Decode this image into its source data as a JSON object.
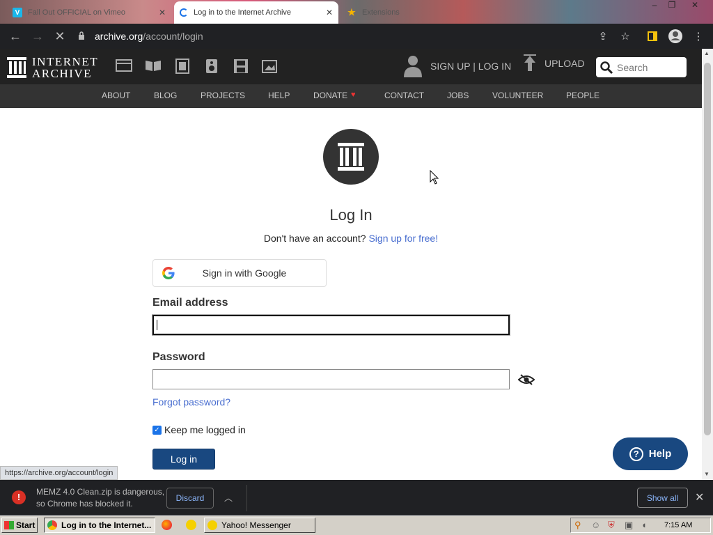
{
  "browser": {
    "tabs": [
      {
        "title": "Fall Out OFFICIAL on Vimeo",
        "favicon": "vimeo-icon"
      },
      {
        "title": "Log in to the Internet Archive",
        "favicon": "loading-icon",
        "active": true
      },
      {
        "title": "Extensions",
        "favicon": "puzzle-icon"
      }
    ],
    "url_host": "archive.org",
    "url_path": "/account/login"
  },
  "ia_header": {
    "logo_line1": "INTERNET",
    "logo_line2": "ARCHIVE",
    "signup_login": "SIGN UP | LOG IN",
    "upload": "UPLOAD",
    "search_placeholder": "Search",
    "nav": [
      "ABOUT",
      "BLOG",
      "PROJECTS",
      "HELP",
      "DONATE",
      "CONTACT",
      "JOBS",
      "VOLUNTEER",
      "PEOPLE"
    ]
  },
  "login": {
    "title": "Log In",
    "no_account": "Don't have an account?",
    "signup_link": "Sign up for free!",
    "google_label": "Sign in with Google",
    "email_label": "Email address",
    "password_label": "Password",
    "forgot": "Forgot password?",
    "keep_logged_in": "Keep me logged in",
    "keep_checked": true,
    "login_button": "Log in",
    "help_button": "Help"
  },
  "status_url": "https://archive.org/account/login",
  "download_bar": {
    "message": "MEMZ 4.0 Clean.zip is dangerous, so Chrome has blocked it.",
    "discard": "Discard",
    "show_all": "Show all"
  },
  "taskbar": {
    "start": "Start",
    "tasks": [
      "Log in to the Internet...",
      "Yahoo! Messenger"
    ],
    "clock": "7:15 AM"
  }
}
